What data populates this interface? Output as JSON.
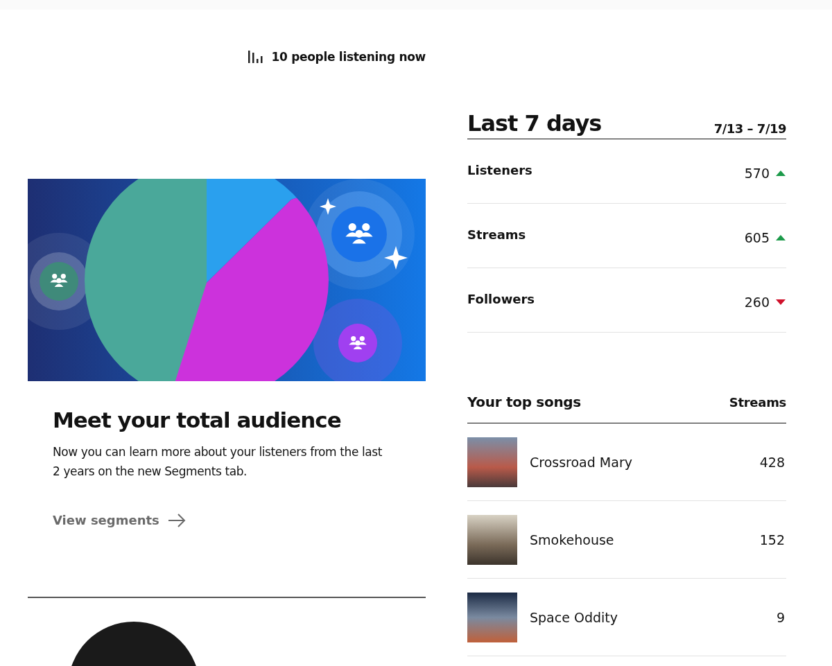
{
  "live": {
    "text": "10 people listening now"
  },
  "promo": {
    "title": "Meet your total audience",
    "body": "Now you can learn more about your listeners from the last 2 years on the new Segments tab.",
    "link": "View segments"
  },
  "stats": {
    "title": "Last 7 days",
    "range": "7/13 – 7/19",
    "items": [
      {
        "label": "Listeners",
        "value": "570",
        "kind": "up"
      },
      {
        "label": "Streams",
        "value": "605",
        "kind": "up"
      },
      {
        "label": "Followers",
        "value": "260",
        "kind": "down"
      }
    ]
  },
  "top_songs": {
    "title": "Your top songs",
    "column": "Streams",
    "rows": [
      {
        "title": "Crossroad Mary",
        "streams": "428"
      },
      {
        "title": "Smokehouse",
        "streams": "152"
      },
      {
        "title": "Space Oddity",
        "streams": "9"
      }
    ]
  }
}
